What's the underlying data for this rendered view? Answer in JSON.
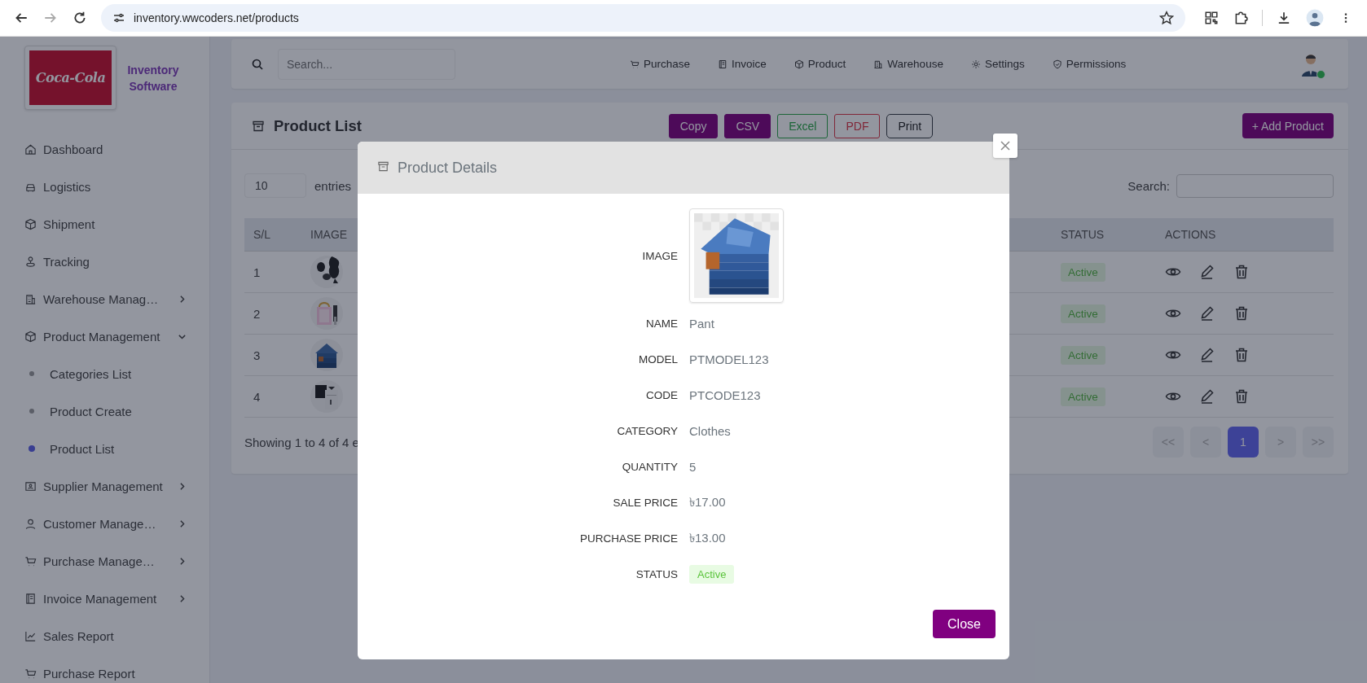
{
  "browser": {
    "url": "inventory.wwcoders.net/products"
  },
  "brand": {
    "logo_text": "Coca-Cola",
    "name": "Inventory Software"
  },
  "sidebar": {
    "items": [
      {
        "label": "Dashboard",
        "kind": "link"
      },
      {
        "label": "Logistics",
        "kind": "link"
      },
      {
        "label": "Shipment",
        "kind": "link"
      },
      {
        "label": "Tracking",
        "kind": "link"
      },
      {
        "label": "Warehouse Manag…",
        "kind": "group",
        "expanded": false
      },
      {
        "label": "Product Management",
        "kind": "group",
        "expanded": true,
        "children": [
          {
            "label": "Categories List",
            "selected": false
          },
          {
            "label": "Product Create",
            "selected": false
          },
          {
            "label": "Product List",
            "selected": true
          }
        ]
      },
      {
        "label": "Supplier Management",
        "kind": "group",
        "expanded": false
      },
      {
        "label": "Customer Manage…",
        "kind": "group",
        "expanded": false
      },
      {
        "label": "Purchase Manage…",
        "kind": "group",
        "expanded": false
      },
      {
        "label": "Invoice Management",
        "kind": "group",
        "expanded": false
      },
      {
        "label": "Sales Report",
        "kind": "link"
      },
      {
        "label": "Purchase Report",
        "kind": "link"
      }
    ]
  },
  "topbar": {
    "search": {
      "placeholder": "Search..."
    },
    "nav": [
      "Purchase",
      "Invoice",
      "Product",
      "Warehouse",
      "Settings",
      "Permissions"
    ],
    "user": {
      "online": true
    }
  },
  "product_list": {
    "title": "Product List",
    "export_buttons": [
      {
        "label": "Copy",
        "kind": "primary"
      },
      {
        "label": "CSV",
        "kind": "primary"
      },
      {
        "label": "Excel",
        "kind": "success"
      },
      {
        "label": "PDF",
        "kind": "danger"
      },
      {
        "label": "Print",
        "kind": "dark"
      }
    ],
    "add_button": "+ Add Product",
    "page_size": "10",
    "entries_label": "entries",
    "search_label": "Search:",
    "table": {
      "columns": [
        "S/L",
        "IMAGE",
        "STATUS",
        "ACTIONS"
      ],
      "rows": [
        {
          "sl": "1",
          "status": "Active"
        },
        {
          "sl": "2",
          "status": "Active"
        },
        {
          "sl": "3",
          "status": "Active"
        },
        {
          "sl": "4",
          "status": "Active"
        }
      ]
    },
    "footer": "Showing 1 to 4 of 4 e",
    "pagination": [
      {
        "label": "<<",
        "selected": false,
        "disabled": true
      },
      {
        "label": "<",
        "selected": false,
        "disabled": true
      },
      {
        "label": "1",
        "selected": true,
        "disabled": false
      },
      {
        "label": ">",
        "selected": false,
        "disabled": true
      },
      {
        "label": ">>",
        "selected": false,
        "disabled": true
      }
    ]
  },
  "modal": {
    "title": "Product Details",
    "fields": [
      {
        "label": "IMAGE"
      },
      {
        "label": "NAME",
        "kind": "text",
        "value": "Pant"
      },
      {
        "label": "MODEL",
        "kind": "text",
        "value": "PTMODEL123"
      },
      {
        "label": "CODE",
        "kind": "text",
        "value": "PTCODE123"
      },
      {
        "label": "CATEGORY",
        "kind": "text",
        "value": "Clothes"
      },
      {
        "label": "QUANTITY",
        "kind": "text",
        "value": "5"
      },
      {
        "label": "SALE PRICE",
        "kind": "text",
        "value": "৳17.00"
      },
      {
        "label": "PURCHASE PRICE",
        "kind": "text",
        "value": "৳13.00"
      },
      {
        "label": "STATUS",
        "kind": "badge",
        "value": "Active"
      }
    ],
    "close_button": "Close"
  }
}
